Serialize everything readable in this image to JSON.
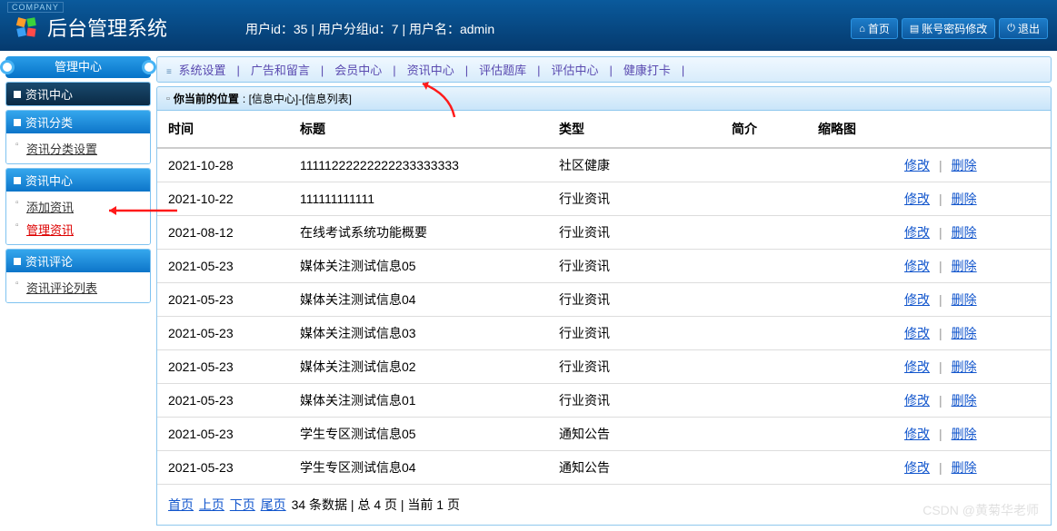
{
  "header": {
    "company_tag": "COMPANY",
    "title": "后台管理系统",
    "user_info": "用户id：35 | 用户分组id：7 | 用户名：admin",
    "buttons": {
      "home": "首页",
      "password": "账号密码修改",
      "logout": "退出"
    }
  },
  "sidebar": {
    "mgmt_center": "管理中心",
    "section_title": "资讯中心",
    "groups": [
      {
        "title": "资讯分类",
        "items": [
          {
            "label": "资讯分类设置",
            "active": false
          }
        ]
      },
      {
        "title": "资讯中心",
        "items": [
          {
            "label": "添加资讯",
            "active": false
          },
          {
            "label": "管理资讯",
            "active": true
          }
        ]
      },
      {
        "title": "资讯评论",
        "items": [
          {
            "label": "资讯评论列表",
            "active": false
          }
        ]
      }
    ]
  },
  "topnav": [
    "系统设置",
    "广告和留言",
    "会员中心",
    "资讯中心",
    "评估题库",
    "评估中心",
    "健康打卡"
  ],
  "breadcrumb": {
    "label": "你当前的位置",
    "path": ": [信息中心]-[信息列表]"
  },
  "table": {
    "headers": {
      "time": "时间",
      "title": "标题",
      "type": "类型",
      "intro": "简介",
      "thumb": "缩略图"
    },
    "actions": {
      "edit": "修改",
      "delete": "删除"
    },
    "rows": [
      {
        "time": "2021-10-28",
        "title": "11111222222222233333333",
        "type": "社区健康",
        "intro": "",
        "thumb": ""
      },
      {
        "time": "2021-10-22",
        "title": "111111111111",
        "type": "行业资讯",
        "intro": "",
        "thumb": ""
      },
      {
        "time": "2021-08-12",
        "title": "在线考试系统功能概要",
        "type": "行业资讯",
        "intro": "",
        "thumb": ""
      },
      {
        "time": "2021-05-23",
        "title": "媒体关注测试信息05",
        "type": "行业资讯",
        "intro": "",
        "thumb": ""
      },
      {
        "time": "2021-05-23",
        "title": "媒体关注测试信息04",
        "type": "行业资讯",
        "intro": "",
        "thumb": ""
      },
      {
        "time": "2021-05-23",
        "title": "媒体关注测试信息03",
        "type": "行业资讯",
        "intro": "",
        "thumb": ""
      },
      {
        "time": "2021-05-23",
        "title": "媒体关注测试信息02",
        "type": "行业资讯",
        "intro": "",
        "thumb": ""
      },
      {
        "time": "2021-05-23",
        "title": "媒体关注测试信息01",
        "type": "行业资讯",
        "intro": "",
        "thumb": ""
      },
      {
        "time": "2021-05-23",
        "title": "学生专区测试信息05",
        "type": "通知公告",
        "intro": "",
        "thumb": ""
      },
      {
        "time": "2021-05-23",
        "title": "学生专区测试信息04",
        "type": "通知公告",
        "intro": "",
        "thumb": ""
      }
    ]
  },
  "pager": {
    "first": "首页",
    "prev": "上页",
    "next": "下页",
    "last": "尾页",
    "summary": "34 条数据 | 总 4 页 | 当前 1 页"
  },
  "watermark": "CSDN @黄菊华老师"
}
